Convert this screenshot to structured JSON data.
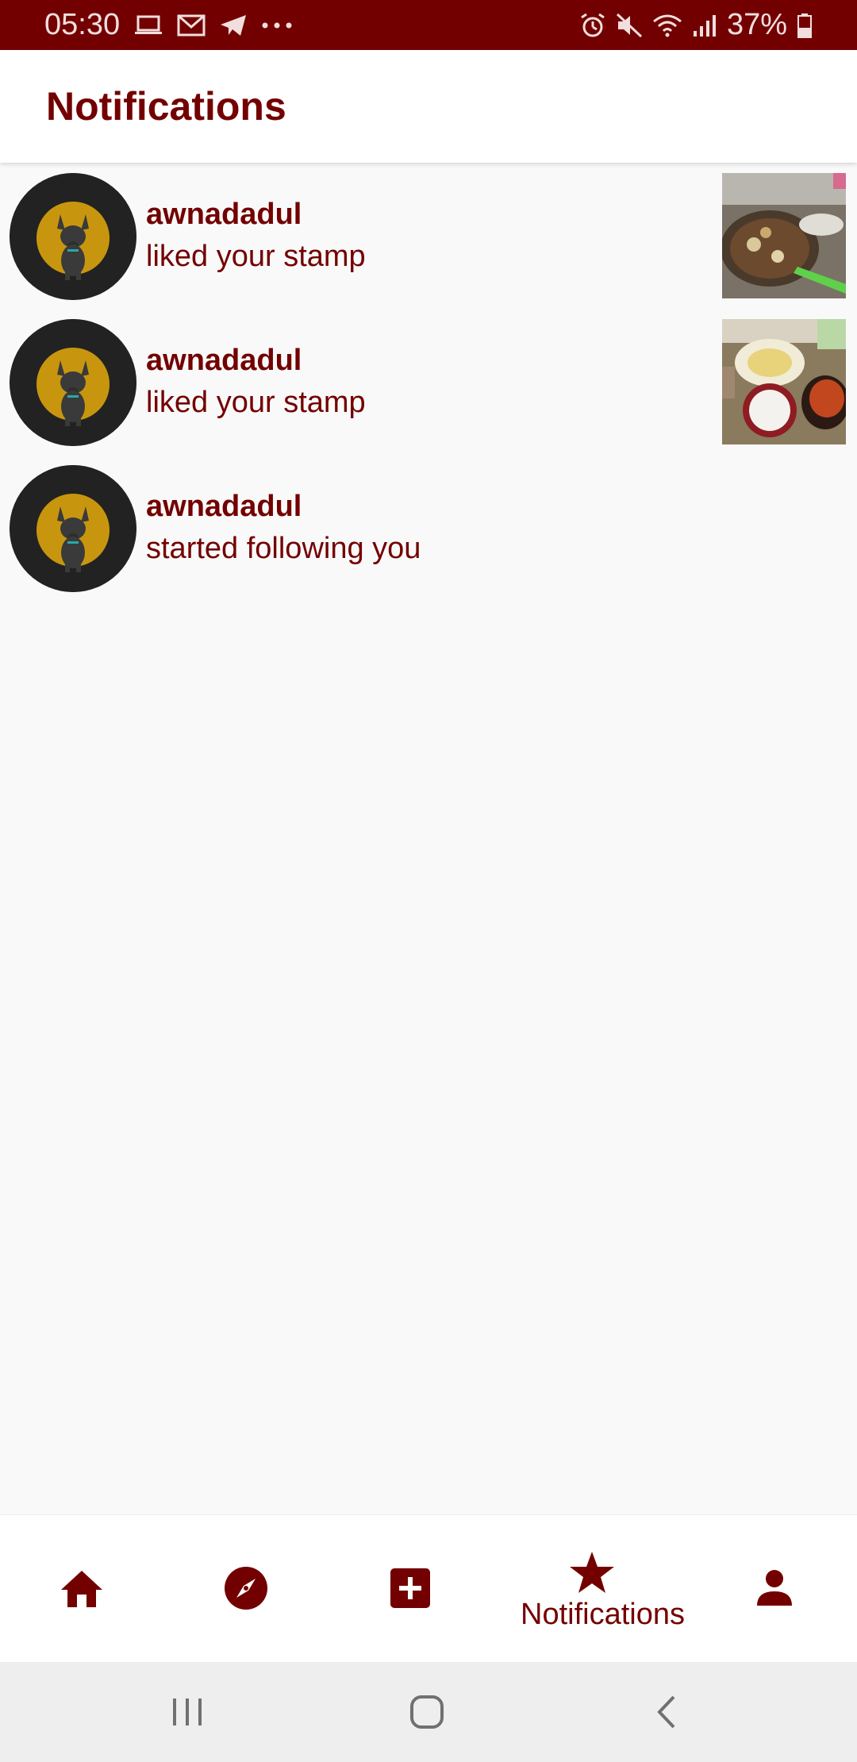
{
  "status_bar": {
    "time": "05:30",
    "battery": "37%",
    "left_icons": [
      "laptop-icon",
      "mail-icon",
      "telegram-icon",
      "more-dots-icon"
    ],
    "right_icons": [
      "alarm-icon",
      "mute-icon",
      "wifi-icon",
      "signal-icon",
      "battery-icon"
    ]
  },
  "header": {
    "title": "Notifications"
  },
  "notifications": [
    {
      "username": "awnadadul",
      "action": "liked your stamp",
      "has_thumbnail": true
    },
    {
      "username": "awnadadul",
      "action": "liked your stamp",
      "has_thumbnail": true
    },
    {
      "username": "awnadadul",
      "action": "started following you",
      "has_thumbnail": false
    }
  ],
  "bottom_nav": {
    "items": [
      {
        "icon": "home-icon"
      },
      {
        "icon": "compass-icon"
      },
      {
        "icon": "add-box-icon"
      },
      {
        "icon": "star-icon",
        "label": "Notifications",
        "active": true
      },
      {
        "icon": "person-icon"
      }
    ]
  },
  "colors": {
    "brand": "#730000",
    "background": "#f9f9f9",
    "appbar": "#ffffff",
    "system_nav": "#eeeeee"
  }
}
